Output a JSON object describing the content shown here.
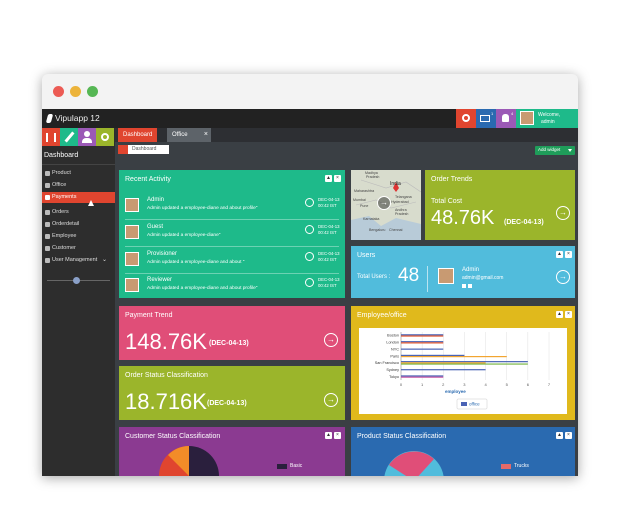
{
  "window": {
    "title": "Vipulapp 12"
  },
  "topbar": {
    "user_welcome": "Welcome,",
    "user_name": "admin",
    "msg_badge": "1",
    "notif_badge": "4"
  },
  "sidebar": {
    "heading": "Dashboard",
    "items": [
      {
        "label": "Product",
        "active": false
      },
      {
        "label": "Office",
        "active": false
      },
      {
        "label": "Payments",
        "active": true
      },
      {
        "label": "Orders",
        "active": false
      },
      {
        "label": "Orderdetail",
        "active": false
      },
      {
        "label": "Employee",
        "active": false
      },
      {
        "label": "Customer",
        "active": false
      },
      {
        "label": "User Management",
        "active": false
      }
    ]
  },
  "tabs": [
    {
      "label": "Dashboard",
      "active": true
    },
    {
      "label": "Office",
      "active": false
    }
  ],
  "breadcrumb": {
    "label": "Dashboard"
  },
  "add_widget_label": "Add widget",
  "recent_activity": {
    "title": "Recent Activity",
    "rows": [
      {
        "name": "Admin",
        "message": "Admin updated a employee-diane and about profile\"",
        "date": "DEC-04-13",
        "time": "00:42 IST"
      },
      {
        "name": "Guest",
        "message": "Admin updated a employee-diane\"",
        "date": "DEC-04-13",
        "time": "00:42 IST"
      },
      {
        "name": "Provisioner",
        "message": "Admin updated a employee-diane and about \"",
        "date": "DEC-04-13",
        "time": "00:42 IST"
      },
      {
        "name": "Reviewer",
        "message": "Admin updated a employee-diane and about profile\"",
        "date": "DEC-04-13",
        "time": "00:42 IST"
      }
    ]
  },
  "map": {
    "labels": [
      "Madhya",
      "Pradesh",
      "India",
      "Maharashtra",
      "Mumbai",
      "Pune",
      "Hyderabad",
      "Telangana",
      "Andhra",
      "Pradesh",
      "Karnataka",
      "Bengaluru",
      "Chennai"
    ]
  },
  "order_trends": {
    "title": "Order Trends",
    "label": "Total Cost",
    "value": "48.76K",
    "date": "(DEC-04-13)"
  },
  "users": {
    "title": "Users",
    "total_label": "Total Users :",
    "total": "48",
    "name": "Admin",
    "email": "admin@gmail.com"
  },
  "payment_trend": {
    "title": "Payment Trend",
    "value": "148.76K",
    "date": "(DEC-04-13)"
  },
  "order_status": {
    "title": "Order Status Classification",
    "value": "18.716K",
    "date": "(DEC-04-13)"
  },
  "employee_office": {
    "title": "Employee/office",
    "chart_data": {
      "type": "bar",
      "orientation": "horizontal",
      "categories": [
        "Boston",
        "London",
        "NYC",
        "Paris",
        "San Francisco",
        "Sydney",
        "Tokyo"
      ],
      "xlabel": "employee",
      "xlim": [
        0,
        7
      ],
      "xticks": [
        "0",
        "1",
        "2",
        "3",
        "4",
        "5",
        "6",
        "7"
      ],
      "series": [
        {
          "values": [
            2,
            2,
            2,
            3,
            6,
            4,
            2
          ],
          "color": "#4a63b5"
        },
        {
          "values": [
            2,
            2,
            0,
            0,
            0,
            0,
            0
          ],
          "color": "#e4572e"
        },
        {
          "values": [
            0,
            0,
            0,
            5,
            4,
            0,
            0
          ],
          "color": "#f2a531"
        },
        {
          "values": [
            0,
            0,
            0,
            0,
            6,
            0,
            0
          ],
          "color": "#7ab648"
        },
        {
          "values": [
            0,
            0,
            0,
            0,
            0,
            0,
            2
          ],
          "color": "#c85ba6"
        }
      ],
      "legend": [
        {
          "label": "office",
          "color": "#4a63b5"
        }
      ],
      "legend_position": "bottom"
    }
  },
  "customer_status": {
    "title": "Customer Status Classification",
    "legend": [
      {
        "label": "Basic",
        "color": "#2a1f3d"
      }
    ]
  },
  "product_status": {
    "title": "Product Status Classification",
    "legend": [
      {
        "label": "Trucks",
        "color": "#e46a6a"
      }
    ]
  },
  "colors": {
    "red": "#e0452f",
    "green": "#1eba8a",
    "olive": "#9bb52b",
    "blue": "#51bcdc",
    "pink": "#e04e78",
    "yellow": "#e0b91c",
    "purple": "#8b3a91",
    "darkblue": "#2a6ab0"
  }
}
